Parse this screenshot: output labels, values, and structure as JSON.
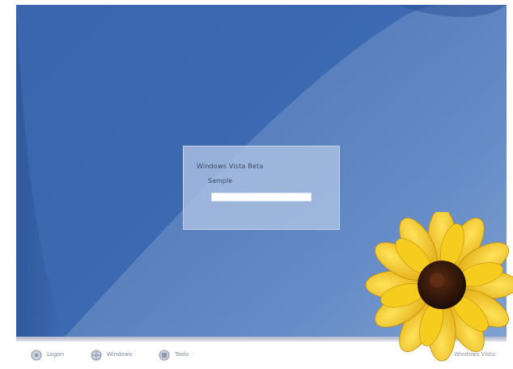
{
  "logon": {
    "prompt": "Windows Vista Beta",
    "username_label": "Sample",
    "username_value": "",
    "username_placeholder": ""
  },
  "bottom_bar": {
    "items": [
      {
        "label": "Logon",
        "icon": "ease-of-access-icon"
      },
      {
        "label": "Windows",
        "icon": "language-icon"
      },
      {
        "label": "Tools",
        "icon": "power-icon"
      }
    ],
    "brand": "Windows Vista"
  },
  "colors": {
    "wallpaper": "#3b68b0",
    "panel": "#b0c4e4",
    "flower_petal": "#f2c318",
    "flower_center": "#3a1a0a"
  }
}
